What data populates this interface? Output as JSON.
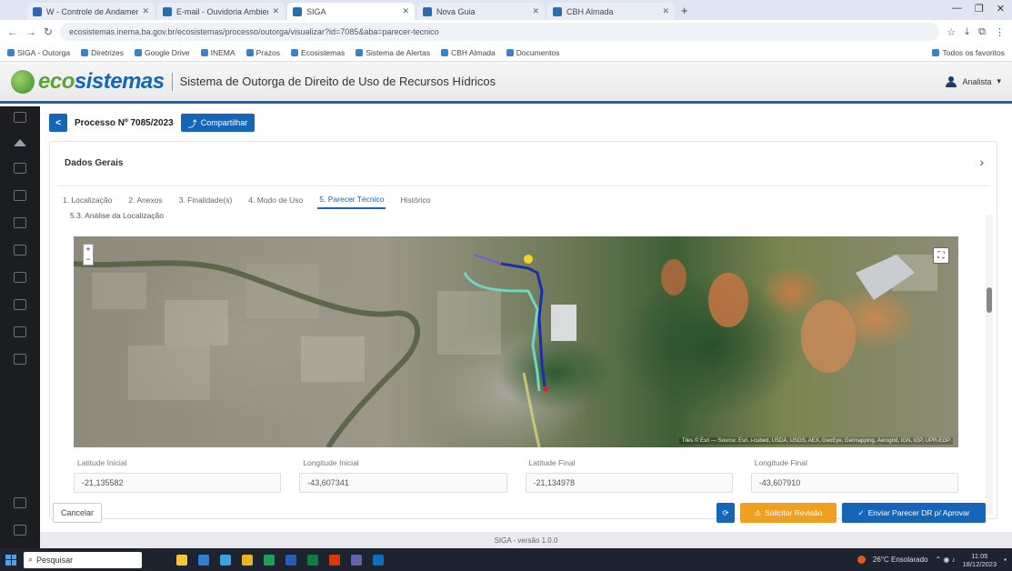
{
  "browser": {
    "tabs": [
      {
        "label": "W - Controle de Andamento",
        "active": false
      },
      {
        "label": "E-mail - Ouvidoria Ambiental",
        "active": false
      },
      {
        "label": "SIGA",
        "active": true
      },
      {
        "label": "Nova Guia",
        "active": false
      },
      {
        "label": "CBH Almada",
        "active": false
      }
    ],
    "url": "ecosistemas.inema.ba.gov.br/ecosistemas/processo/outorga/visualizar?id=7085&aba=parecer-tecnico",
    "bookmarks": [
      "SIGA - Outorga",
      "Diretrizes",
      "Google Drive",
      "INEMA",
      "Prazos",
      "Ecosistemas",
      "Sistema de Alertas",
      "CBH Almada",
      "Documentos",
      "Todos os favoritos"
    ]
  },
  "app": {
    "logo_eco": "eco",
    "logo_sis": "sistemas",
    "title": "Sistema de Outorga de Direito de Uso de Recursos Hídricos",
    "user": "Analista"
  },
  "process": {
    "back_label": "<",
    "title": "Processo Nº 7085/2023",
    "share_label": "Compartilhar"
  },
  "section": {
    "header": "Dados Gerais",
    "tabs": [
      {
        "label": "1. Localização",
        "active": false
      },
      {
        "label": "2. Anexos",
        "active": false
      },
      {
        "label": "3. Finalidade(s)",
        "active": false
      },
      {
        "label": "4. Modo de Uso",
        "active": false
      },
      {
        "label": "5. Parecer Técnico",
        "active": true
      },
      {
        "label": "Histórico",
        "active": false
      }
    ],
    "subtitle": "5.3. Análise da Localização"
  },
  "map": {
    "zoom_in": "+",
    "zoom_out": "−",
    "attribution": "Tiles © Esri — Source: Esri, i-cubed, USDA, USGS, AEX, GeoEye, Getmapping, Aerogrid, IGN, IGP, UPR-EGP"
  },
  "coords": [
    {
      "label": "Latitude Inicial",
      "value": "-21,135582"
    },
    {
      "label": "Longitude Inicial",
      "value": "-43,607341"
    },
    {
      "label": "Latitude Final",
      "value": "-21,134978"
    },
    {
      "label": "Longitude Final",
      "value": "-43,607910"
    }
  ],
  "footer": {
    "cancel": "Cancelar",
    "small_btn": "⟳",
    "warn_btn": "Solicitar Revisão",
    "primary_btn": "Enviar Parecer DR p/ Aprovar",
    "version": "SIGA - versão 1.0.0"
  },
  "taskbar": {
    "search": "Pesquisar",
    "weather": "26°C Ensolarado",
    "time": "11:05",
    "date": "18/12/2023"
  },
  "colors": {
    "brand_blue": "#1566b8",
    "brand_green": "#5aa43a",
    "warn": "#f0a020"
  }
}
